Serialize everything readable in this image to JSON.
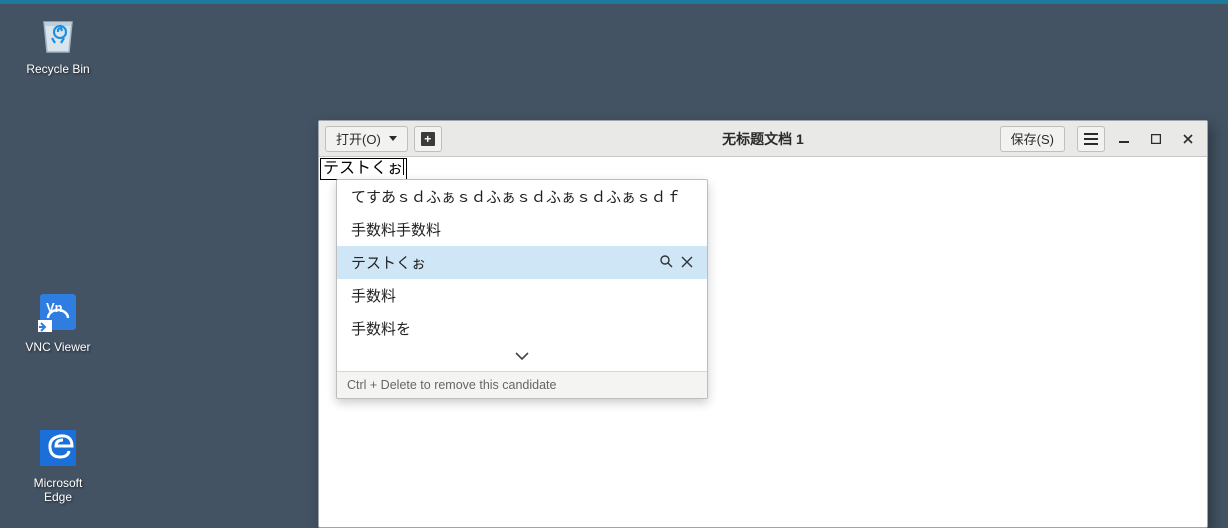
{
  "desktop": {
    "icons": [
      {
        "name": "recycle-bin",
        "label": "Recycle Bin"
      },
      {
        "name": "vnc-viewer",
        "label": "VNC Viewer"
      },
      {
        "name": "microsoft-edge",
        "label": "Microsoft Edge"
      }
    ]
  },
  "window": {
    "open_label": "打开(O)",
    "title": "无标题文档 1",
    "save_label": "保存(S)"
  },
  "ime": {
    "composition": "テストくぉ",
    "candidates": [
      "てすあｓｄふぁｓｄふぁｓｄふぁｓｄふぁｓｄｆ",
      "手数料手数料",
      "テストくぉ",
      "手数料",
      "手数料を"
    ],
    "selected_index": 2,
    "hint": "Ctrl + Delete to remove this candidate"
  }
}
